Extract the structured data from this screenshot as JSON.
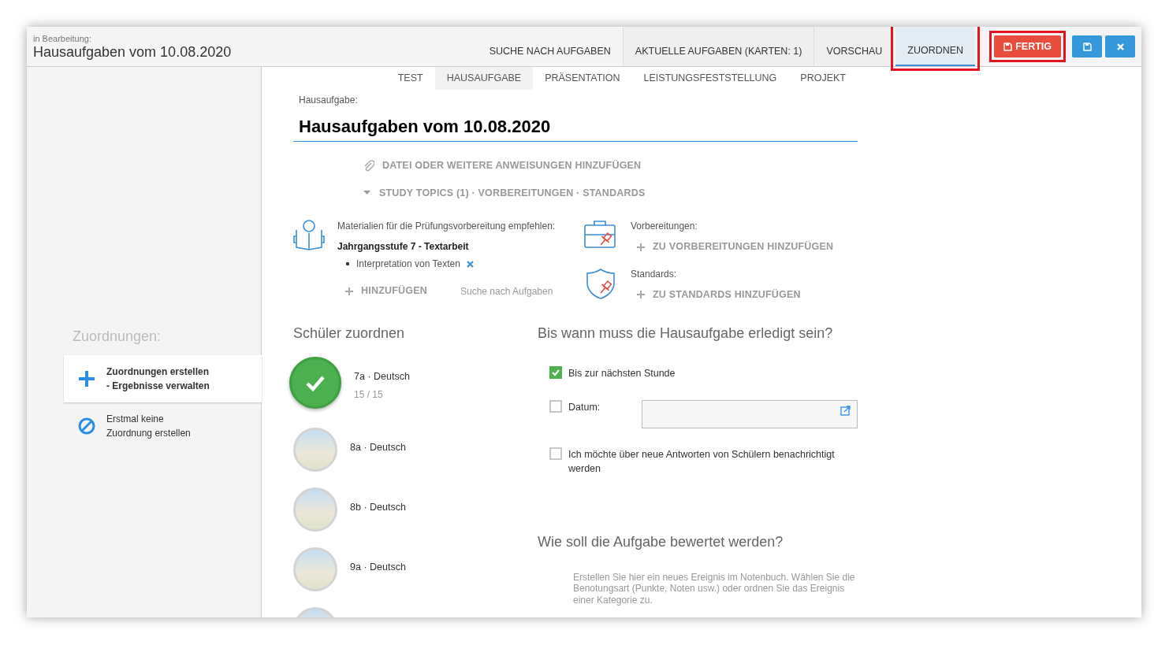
{
  "header": {
    "caption": "in Bearbeitung:",
    "title": "Hausaufgaben vom 10.08.2020",
    "tabs": [
      {
        "label": "SUCHE NACH AUFGABEN",
        "selected": false,
        "highlighted": false
      },
      {
        "label": "AKTUELLE AUFGABEN (KARTEN: 1)",
        "selected": false,
        "highlighted": false
      },
      {
        "label": "VORSCHAU",
        "selected": false,
        "highlighted": false
      },
      {
        "label": "ZUORDNEN",
        "selected": true,
        "highlighted": true
      }
    ],
    "done_button": {
      "label": "FERTIG",
      "highlighted": true
    }
  },
  "sidebar": {
    "title": "Zuordnungen:",
    "items": [
      {
        "lines": [
          "Zuordnungen erstellen",
          "- Ergebnisse verwalten"
        ],
        "selected": true,
        "kind": "plus"
      },
      {
        "lines": [
          "Erstmal keine",
          "Zuordnung erstellen"
        ],
        "selected": false,
        "kind": "none"
      }
    ]
  },
  "type_tabs": [
    {
      "label": "TEST",
      "selected": false
    },
    {
      "label": "HAUSAUFGABE",
      "selected": true
    },
    {
      "label": "PRÄSENTATION",
      "selected": false
    },
    {
      "label": "LEISTUNGSFESTSTELLUNG",
      "selected": false
    },
    {
      "label": "PROJEKT",
      "selected": false
    }
  ],
  "task": {
    "label": "Hausaufgabe:",
    "value": "Hausaufgaben vom 10.08.2020"
  },
  "attach_link": "DATEI ODER WEITERE ANWEISUNGEN HINZUFÜGEN",
  "topics_toggle": {
    "label": "STUDY TOPICS (1) · VORBEREITUNGEN · STANDARDS",
    "expanded": true
  },
  "materials": {
    "label": "Materialien für die Prüfungsvorbereitung empfehlen:",
    "group": "Jahrgangsstufe 7 - Textarbeit",
    "items": [
      "Interpretation von Texten"
    ],
    "add": "HINZUFÜGEN",
    "search": "Suche nach Aufgaben"
  },
  "preparations": {
    "label": "Vorbereitungen:",
    "add": "ZU VORBEREITUNGEN HINZUFÜGEN"
  },
  "standards": {
    "label": "Standards:",
    "add": "ZU STANDARDS HINZUFÜGEN"
  },
  "students": {
    "title": "Schüler zuordnen",
    "classes": [
      {
        "name": "7a · Deutsch",
        "count": "15 / 15",
        "selected": true
      },
      {
        "name": "8a · Deutsch",
        "selected": false
      },
      {
        "name": "8b · Deutsch",
        "selected": false
      },
      {
        "name": "9a · Deutsch",
        "selected": false
      },
      {
        "selected": false
      }
    ]
  },
  "due": {
    "title": "Bis wann muss die Hausaufgabe erledigt sein?",
    "options": [
      {
        "label": "Bis zur nächsten Stunde",
        "checked": true,
        "kind": "plain"
      },
      {
        "label": "Datum:",
        "checked": false,
        "kind": "date"
      },
      {
        "label": "Ich möchte über neue Antworten von Schülern benachrichtigt werden",
        "checked": false,
        "kind": "plain"
      }
    ]
  },
  "grading": {
    "title": "Wie soll die Aufgabe bewertet werden?",
    "description": "Erstellen Sie hier ein neues Ereignis im Notenbuch. Wählen Sie die Benotungsart (Punkte, Noten usw.) oder ordnen Sie das Ereignis einer Kategorie zu."
  }
}
